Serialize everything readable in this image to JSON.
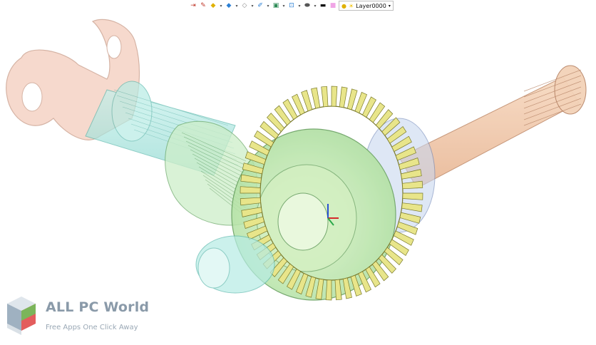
{
  "toolbar": {
    "layer_label": "Layer0000",
    "tools": [
      {
        "name": "exit-icon",
        "glyph": "⇥",
        "color": "#c0392b"
      },
      {
        "name": "pen-icon",
        "glyph": "✎",
        "color": "#c0392b"
      },
      {
        "name": "box-yellow-icon",
        "glyph": "◆",
        "color": "#e0b100"
      },
      {
        "name": "cube-icon",
        "glyph": "◆",
        "color": "#2a7fd4"
      },
      {
        "name": "shapes-icon",
        "glyph": "◇",
        "color": "#888888"
      },
      {
        "name": "paint-icon",
        "glyph": "✐",
        "color": "#2a7fd4"
      },
      {
        "name": "render-icon",
        "glyph": "▣",
        "color": "#2e8b57"
      },
      {
        "name": "section-icon",
        "glyph": "⊡",
        "color": "#2a7fd4"
      },
      {
        "name": "database-icon",
        "glyph": "⬬",
        "color": "#555555"
      },
      {
        "name": "line-weight-icon",
        "glyph": "▬",
        "color": "#111111"
      },
      {
        "name": "color-swatch-icon",
        "glyph": "■",
        "color": "#f0a5e6"
      }
    ]
  },
  "watermark": {
    "title": "ALL PC World",
    "subtitle": "Free Apps One Click Away"
  },
  "colors": {
    "gear_yellow": "#e8e58a",
    "gear_stroke": "#7a7a2a",
    "carrier_green": "#b9e6a8",
    "shaft_cyan": "#9fe3dc",
    "yoke_pink": "#f2c6b4",
    "axle_peach": "#f3c9a8"
  }
}
